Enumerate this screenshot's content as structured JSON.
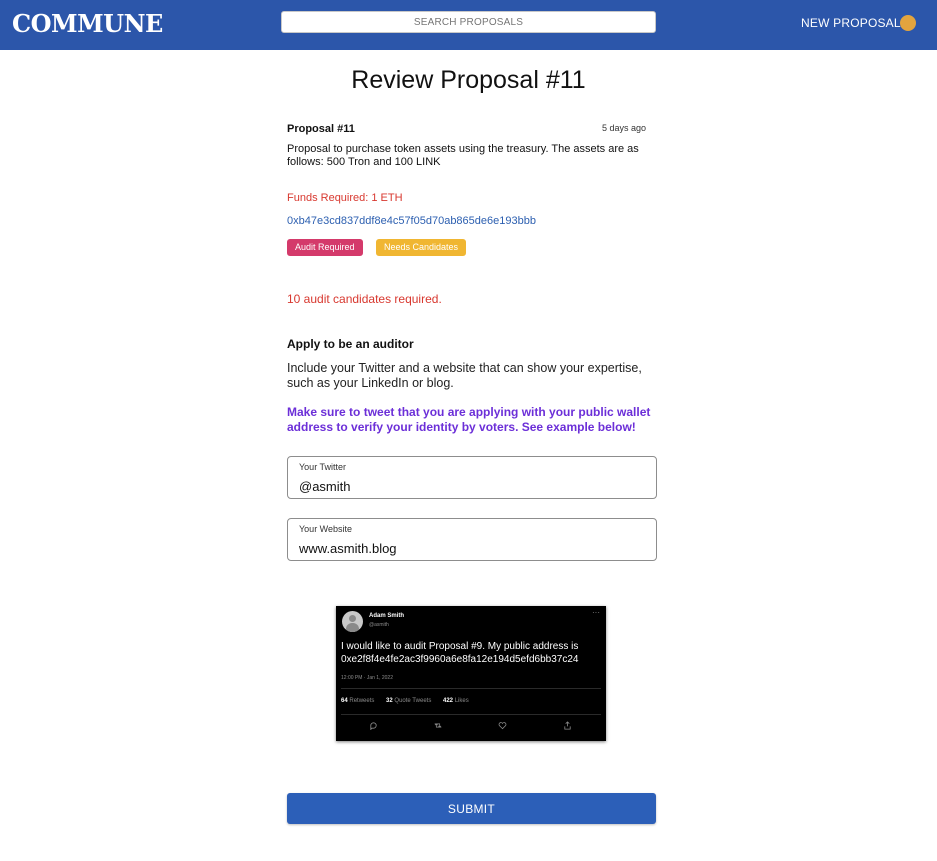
{
  "header": {
    "logo": "COMMUNE",
    "search_placeholder": "SEARCH PROPOSALS",
    "new_proposal": "NEW PROPOSAL"
  },
  "page_title": "Review Proposal #11",
  "proposal": {
    "title": "Proposal #11",
    "time": "5 days ago",
    "description": "Proposal to purchase token assets using the treasury. The assets are as follows: 500 Tron and 100 LINK",
    "funds": "Funds Required: 1 ETH",
    "address": "0xb47e3cd837ddf8e4c57f05d70ab865de6e193bbb",
    "badges": [
      "Audit Required",
      "Needs Candidates"
    ]
  },
  "candidates_required": "10 audit candidates required.",
  "apply": {
    "heading": "Apply to be an auditor",
    "description": "Include your Twitter and a website that can show your expertise, such as your LinkedIn or blog.",
    "warning": "Make sure to tweet that you are applying with your public wallet address to verify your identity by voters. See example below!"
  },
  "fields": {
    "twitter_label": "Your Twitter",
    "twitter_value": "@asmith",
    "website_label": "Your Website",
    "website_value": "www.asmith.blog"
  },
  "tweet": {
    "name": "Adam Smith",
    "handle": "@asmith",
    "more": "···",
    "text": "I would like to audit Proposal #9. My public address is 0xe2f8f4e4fe2ac3f9960a6e8fa12e194d5efd6bb37c24",
    "date": "12:00 PM · Jan 1, 2022",
    "retweets_count": "64",
    "retweets_label": "Retweets",
    "quotes_count": "32",
    "quotes_label": "Quote Tweets",
    "likes_count": "422",
    "likes_label": "Likes"
  },
  "submit_label": "SUBMIT"
}
